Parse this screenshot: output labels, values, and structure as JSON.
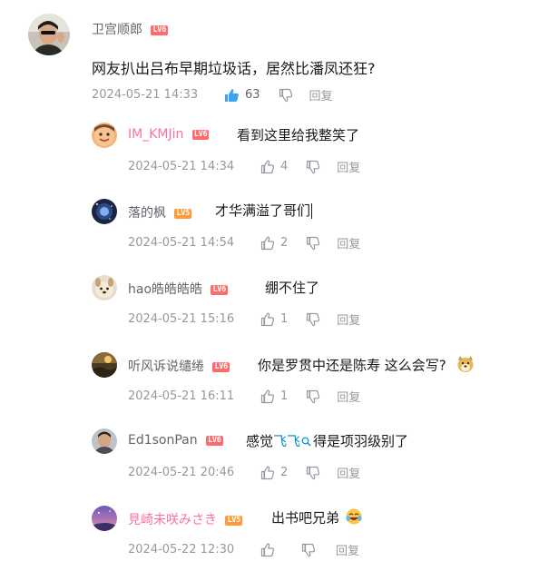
{
  "main": {
    "username": "卫宫顺郎",
    "level": "LV6",
    "content": "网友扒出吕布早期垃圾话，居然比潘凤还狂?",
    "time": "2024-05-21 14:33",
    "likes": "63",
    "reply_label": "回复",
    "like_active_color": "#3ba5f0"
  },
  "replies": [
    {
      "username": "IM_KMJin",
      "level": "LV6",
      "content": "看到这里给我整笑了",
      "time": "2024-05-21 14:34",
      "likes": "4",
      "reply_label": "回复",
      "name_color": "#fb7299"
    },
    {
      "username": "落的枫",
      "level": "LV5",
      "content": "才华满溢了哥们",
      "time": "2024-05-21 14:54",
      "likes": "2",
      "reply_label": "回复"
    },
    {
      "username": "hao皓皓皓皓",
      "level": "LV6",
      "content": "绷不住了",
      "time": "2024-05-21 15:16",
      "likes": "1",
      "reply_label": "回复"
    },
    {
      "username": "听风诉说缱绻",
      "level": "LV6",
      "content": "你是罗贯中还是陈寿 这么会写?",
      "time": "2024-05-21 16:11",
      "likes": "1",
      "reply_label": "回复",
      "emoji": "doge"
    },
    {
      "username": "Ed1sonPan",
      "level": "LV6",
      "content_pre": "感觉",
      "content_link": "飞飞",
      "content_post": "得是项羽级别了",
      "time": "2024-05-21 20:46",
      "likes": "2",
      "reply_label": "回复"
    },
    {
      "username": "見崎未咲みさき",
      "level": "LV5",
      "content": "出书吧兄弟",
      "time": "2024-05-22 12:30",
      "likes": "",
      "reply_label": "回复",
      "name_color": "#fb7299",
      "emoji": "laugh-cry"
    }
  ]
}
